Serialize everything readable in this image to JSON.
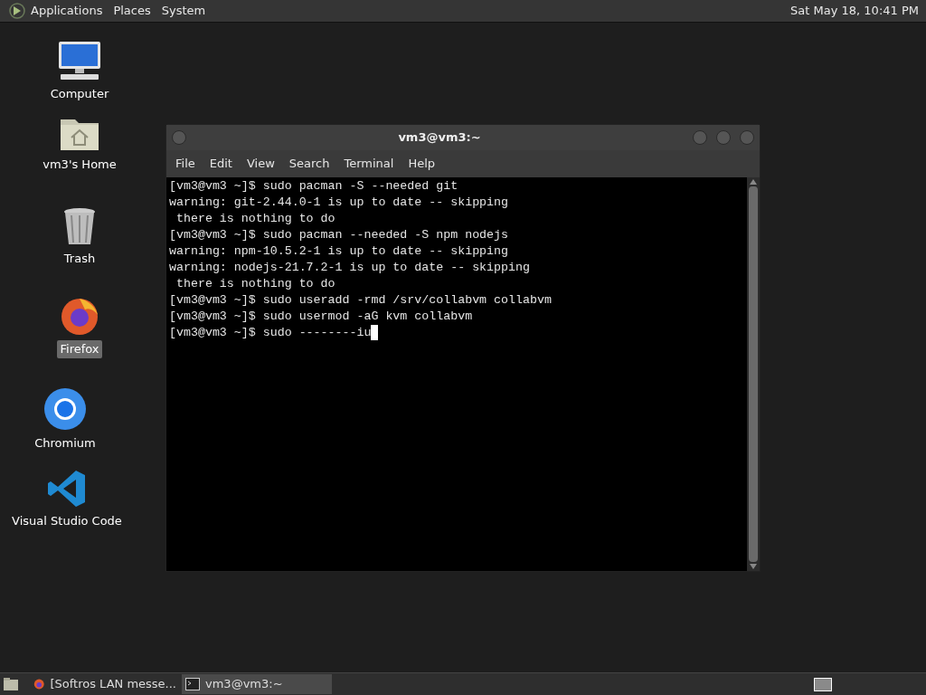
{
  "top_panel": {
    "menus": [
      "Applications",
      "Places",
      "System"
    ],
    "clock": "Sat May 18, 10:41 PM"
  },
  "desktop_icons": [
    {
      "kind": "computer",
      "label": "Computer",
      "selected": false
    },
    {
      "kind": "home",
      "label": "vm3's Home",
      "selected": false
    },
    {
      "kind": "trash",
      "label": "Trash",
      "selected": false
    },
    {
      "kind": "firefox",
      "label": "Firefox",
      "selected": true
    },
    {
      "kind": "chromium",
      "label": "Chromium",
      "selected": false
    },
    {
      "kind": "vscode",
      "label": "Visual Studio Code",
      "selected": false
    }
  ],
  "terminal": {
    "title": "vm3@vm3:~",
    "menu": [
      "File",
      "Edit",
      "View",
      "Search",
      "Terminal",
      "Help"
    ],
    "lines": [
      "[vm3@vm3 ~]$ sudo pacman -S --needed git",
      "warning: git-2.44.0-1 is up to date -- skipping",
      " there is nothing to do",
      "[vm3@vm3 ~]$ sudo pacman --needed -S npm nodejs",
      "warning: npm-10.5.2-1 is up to date -- skipping",
      "warning: nodejs-21.7.2-1 is up to date -- skipping",
      " there is nothing to do",
      "[vm3@vm3 ~]$ sudo useradd -rmd /srv/collabvm collabvm",
      "[vm3@vm3 ~]$ sudo usermod -aG kvm collabvm",
      "[vm3@vm3 ~]$ sudo --------iu"
    ],
    "cursor": true
  },
  "taskbar": {
    "items": [
      {
        "kind": "firefox",
        "label": "[Softros LAN messe...",
        "selected": false
      },
      {
        "kind": "terminal",
        "label": "vm3@vm3:~",
        "selected": true
      }
    ]
  }
}
